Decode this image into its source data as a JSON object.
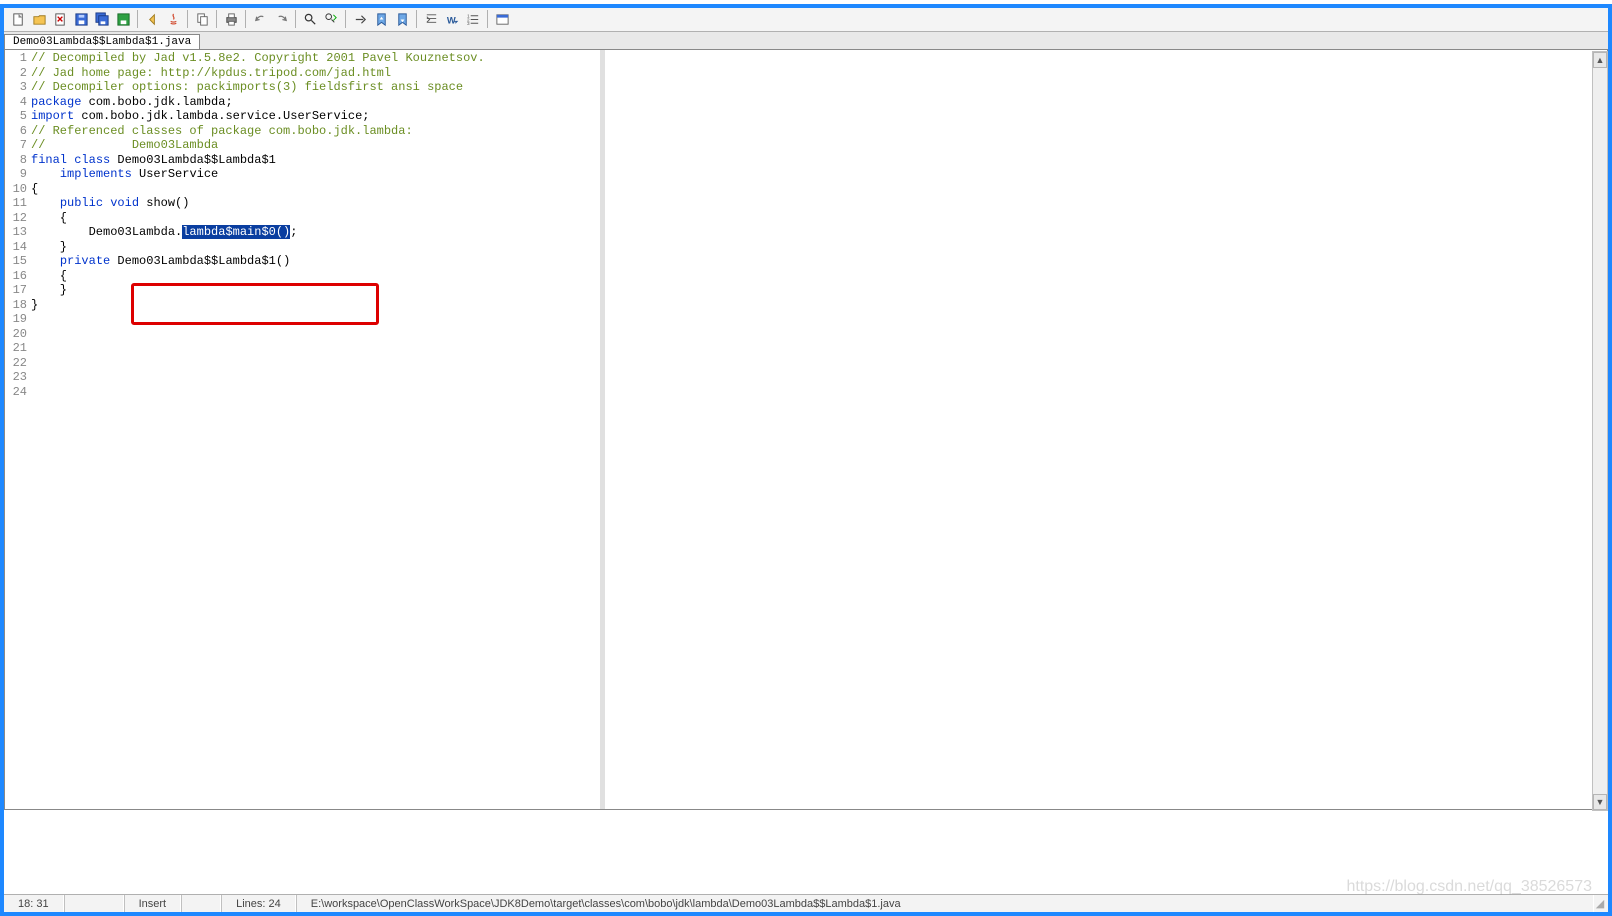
{
  "tab": {
    "label": "Demo03Lambda$$Lambda$1.java"
  },
  "icons": {
    "new": "new-file",
    "open": "open",
    "close": "close-x",
    "save": "save",
    "saveall": "save-all",
    "saveas": "save-as",
    "back": "back",
    "java": "java",
    "copy": "copy",
    "print": "print",
    "undo": "undo",
    "redo": "redo",
    "find": "find",
    "findnext": "find-next",
    "goto": "goto",
    "bookmark": "bookmark",
    "sort": "sort",
    "wordwrap": "word-wrap",
    "list": "list",
    "options": "options"
  },
  "code": {
    "lines": [
      {
        "n": 1,
        "seg": [
          {
            "t": "// Decompiled by Jad v1.5.8e2. Copyright 2001 Pavel Kouznetsov.",
            "c": "comment"
          }
        ]
      },
      {
        "n": 2,
        "seg": [
          {
            "t": "// Jad home page: http://kpdus.tripod.com/jad.html",
            "c": "comment"
          }
        ]
      },
      {
        "n": 3,
        "seg": [
          {
            "t": "// Decompiler options: packimports(3) fieldsfirst ansi space ",
            "c": "comment"
          }
        ]
      },
      {
        "n": 4,
        "seg": [
          {
            "t": "",
            "c": ""
          }
        ]
      },
      {
        "n": 5,
        "seg": [
          {
            "t": "package",
            "c": "kw"
          },
          {
            "t": " com.bobo.jdk.lambda;",
            "c": ""
          }
        ]
      },
      {
        "n": 6,
        "seg": [
          {
            "t": "",
            "c": ""
          }
        ]
      },
      {
        "n": 7,
        "seg": [
          {
            "t": "import",
            "c": "kw"
          },
          {
            "t": " com.bobo.jdk.lambda.service.UserService;",
            "c": ""
          }
        ]
      },
      {
        "n": 8,
        "seg": [
          {
            "t": "",
            "c": ""
          }
        ]
      },
      {
        "n": 9,
        "seg": [
          {
            "t": "// Referenced classes of package com.bobo.jdk.lambda:",
            "c": "comment"
          }
        ]
      },
      {
        "n": 10,
        "seg": [
          {
            "t": "//            Demo03Lambda",
            "c": "comment"
          }
        ]
      },
      {
        "n": 11,
        "seg": [
          {
            "t": "",
            "c": ""
          }
        ]
      },
      {
        "n": 12,
        "seg": [
          {
            "t": "final",
            "c": "kw"
          },
          {
            "t": " ",
            "c": ""
          },
          {
            "t": "class",
            "c": "kw"
          },
          {
            "t": " Demo03Lambda$$Lambda$1",
            "c": ""
          }
        ]
      },
      {
        "n": 13,
        "seg": [
          {
            "t": "    ",
            "c": ""
          },
          {
            "t": "implements",
            "c": "kw"
          },
          {
            "t": " UserService",
            "c": ""
          }
        ]
      },
      {
        "n": 14,
        "seg": [
          {
            "t": "{",
            "c": ""
          }
        ]
      },
      {
        "n": 15,
        "seg": [
          {
            "t": "",
            "c": ""
          }
        ]
      },
      {
        "n": 16,
        "seg": [
          {
            "t": "    ",
            "c": ""
          },
          {
            "t": "public",
            "c": "kw"
          },
          {
            "t": " ",
            "c": ""
          },
          {
            "t": "void",
            "c": "kw"
          },
          {
            "t": " show()",
            "c": ""
          }
        ]
      },
      {
        "n": 17,
        "seg": [
          {
            "t": "    {",
            "c": ""
          }
        ]
      },
      {
        "n": 18,
        "seg": [
          {
            "t": "        Demo03Lambda.",
            "c": ""
          },
          {
            "t": "lambda$main$0()",
            "c": "selected"
          },
          {
            "t": ";",
            "c": ""
          }
        ]
      },
      {
        "n": 19,
        "seg": [
          {
            "t": "    }",
            "c": ""
          }
        ]
      },
      {
        "n": 20,
        "seg": [
          {
            "t": "",
            "c": ""
          }
        ]
      },
      {
        "n": 21,
        "seg": [
          {
            "t": "    ",
            "c": ""
          },
          {
            "t": "private",
            "c": "kw"
          },
          {
            "t": " Demo03Lambda$$Lambda$1()",
            "c": ""
          }
        ]
      },
      {
        "n": 22,
        "seg": [
          {
            "t": "    {",
            "c": ""
          }
        ]
      },
      {
        "n": 23,
        "seg": [
          {
            "t": "    }",
            "c": ""
          }
        ]
      },
      {
        "n": 24,
        "seg": [
          {
            "t": "}",
            "c": ""
          }
        ]
      }
    ]
  },
  "status": {
    "pos": "18: 31",
    "mode": "Insert",
    "lines": "Lines: 24",
    "path": "E:\\workspace\\OpenClassWorkSpace\\JDK8Demo\\target\\classes\\com\\bobo\\jdk\\lambda\\Demo03Lambda$$Lambda$1.java"
  },
  "watermark": "https://blog.csdn.net/qq_38526573"
}
